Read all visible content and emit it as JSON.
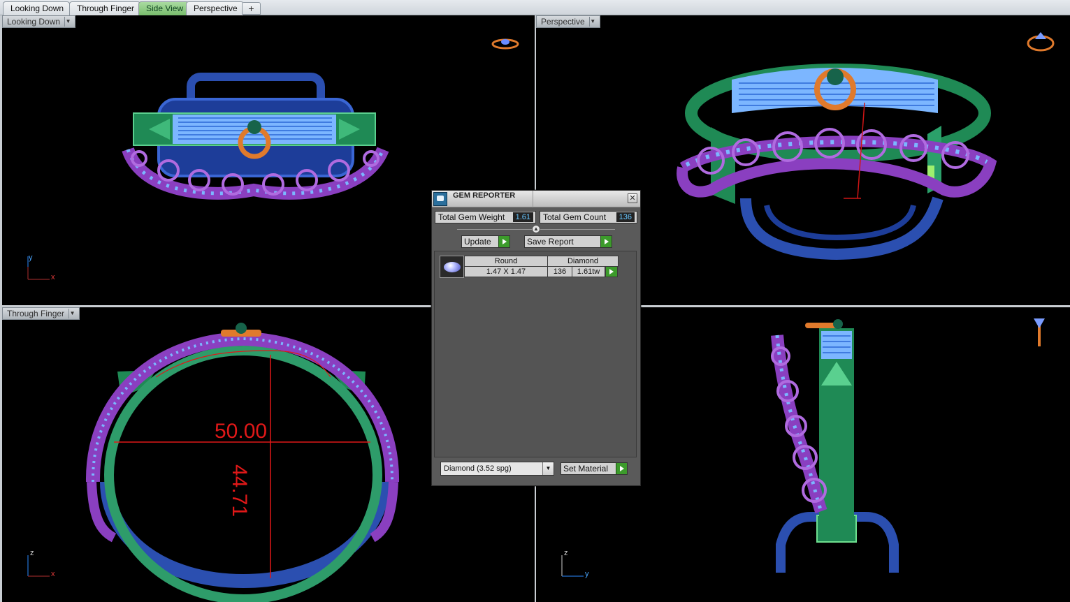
{
  "tabs": [
    {
      "label": "Looking Down",
      "active": false
    },
    {
      "label": "Through Finger",
      "active": false
    },
    {
      "label": "Side View",
      "active": true
    },
    {
      "label": "Perspective",
      "active": false
    }
  ],
  "tab_add_symbol": "+",
  "viewports": {
    "top_left": {
      "label": "Looking Down",
      "axis_v": "y",
      "axis_h": "x"
    },
    "top_right": {
      "label": "Perspective"
    },
    "bottom_left": {
      "label": "Through Finger",
      "axis_v": "z",
      "axis_h": "x",
      "dim_width": "50.00",
      "dim_height": "44.71"
    },
    "bottom_right": {
      "label": "",
      "axis_v": "z",
      "axis_h": "y"
    }
  },
  "dropdown_symbol": "▼",
  "gem_reporter": {
    "title": "GEM REPORTER",
    "close_symbol": "✕",
    "total_weight_label": "Total Gem Weight",
    "total_weight_value": "1.61",
    "total_count_label": "Total Gem Count",
    "total_count_value": "136",
    "update_label": "Update",
    "save_report_label": "Save Report",
    "table": {
      "shape": "Round",
      "material": "Diamond",
      "size": "1.47 X 1.47",
      "count": "136",
      "weight": "1.61tw"
    },
    "material_select": "Diamond    (3.52 spg)",
    "set_material_label": "Set Material"
  },
  "colors": {
    "viewport_bg": "#000000",
    "metal_blue": "#2b4fb0",
    "metal_green": "#1f8a55",
    "purple_chain": "#8a3fc0",
    "gem_blue": "#7cb6ff",
    "orange_bail": "#e07a2c",
    "dimension_red": "#e01818",
    "active_tab": "#79bd6d"
  }
}
